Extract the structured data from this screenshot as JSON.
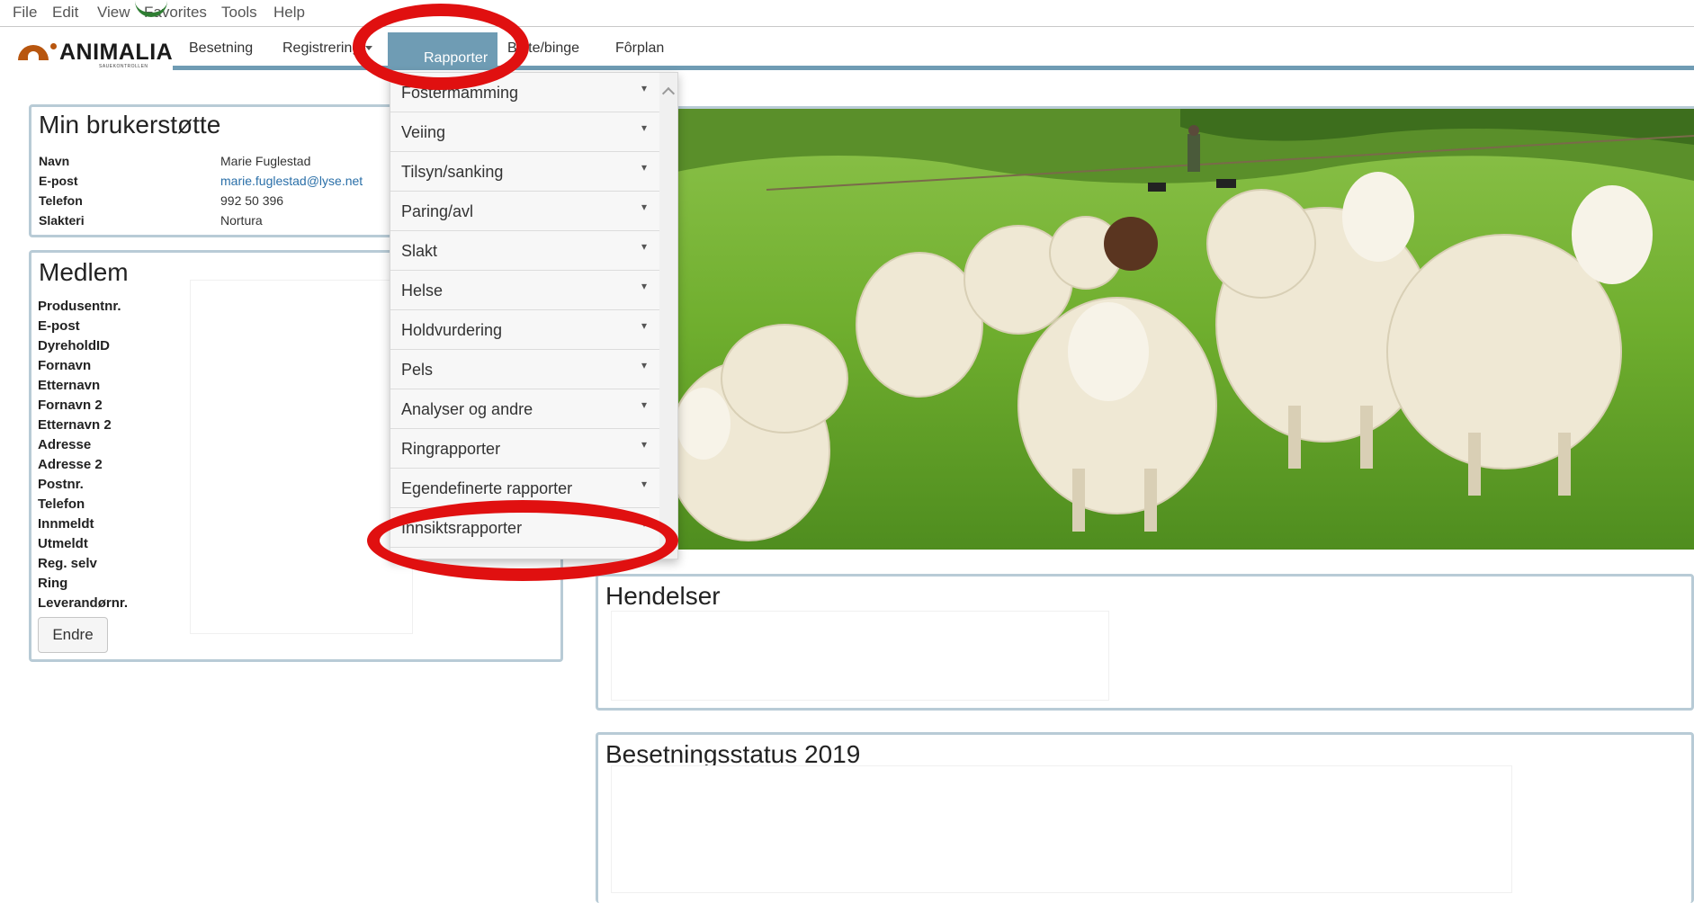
{
  "browser_menu": [
    "File",
    "Edit",
    "View",
    "Favorites",
    "Tools",
    "Help"
  ],
  "logo": {
    "name": "ANIMALIA",
    "sub": "SAUEKONTROLLEN"
  },
  "nav": {
    "items": [
      {
        "label": "Besetning"
      },
      {
        "label": "Registrering"
      },
      {
        "label": "Rapporter"
      },
      {
        "label": "Beite/binge"
      },
      {
        "label": "Fôrplan"
      }
    ]
  },
  "dropdown": {
    "items": [
      "Fostermamming",
      "Veiing",
      "Tilsyn/sanking",
      "Paring/avl",
      "Slakt",
      "Helse",
      "Holdvurdering",
      "Pels",
      "Analyser og andre",
      "Ringrapporter",
      "Egendefinerte rapporter",
      "Innsiktsrapporter"
    ]
  },
  "support": {
    "title": "Min brukerstøtte",
    "rows": [
      {
        "label": "Navn",
        "value": "Marie Fuglestad"
      },
      {
        "label": "E-post",
        "value": "marie.fuglestad@lyse.net"
      },
      {
        "label": "Telefon",
        "value": "992 50 396"
      },
      {
        "label": "Slakteri",
        "value": "Nortura"
      }
    ]
  },
  "member": {
    "title": "Medlem",
    "labels": [
      "Produsentnr.",
      "E-post",
      "DyreholdID",
      "Fornavn",
      "Etternavn",
      "Fornavn 2",
      "Etternavn 2",
      "Adresse",
      "Adresse 2",
      "Postnr.",
      "Telefon",
      "Innmeldt",
      "Utmeldt",
      "Reg. selv",
      "Ring",
      "Leverandørnr."
    ],
    "edit_button": "Endre"
  },
  "events": {
    "title": "Hendelser"
  },
  "status": {
    "title": "Besetningsstatus 2019"
  },
  "colors": {
    "accent": "#6f9cb4",
    "panel_border": "#b8cbd6",
    "highlight": "#e01010"
  }
}
